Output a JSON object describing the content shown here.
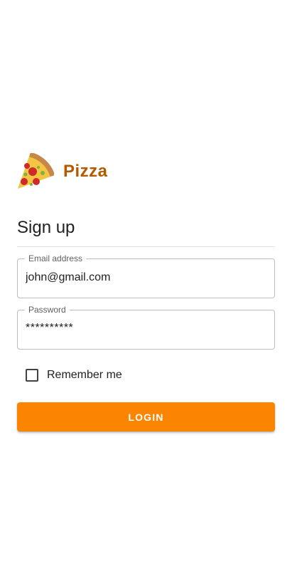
{
  "brand": {
    "name": "Pizza",
    "logo_icon": "pizza-slice-icon",
    "color": "#b35a00"
  },
  "form": {
    "heading": "Sign up",
    "email": {
      "label": "Email address",
      "value": "john@gmail.com"
    },
    "password": {
      "label": "Password",
      "masked_value": "**********"
    },
    "remember": {
      "label": "Remember me",
      "checked": false
    },
    "login_button": {
      "label": "LOGIN",
      "color": "#fb8500"
    }
  }
}
